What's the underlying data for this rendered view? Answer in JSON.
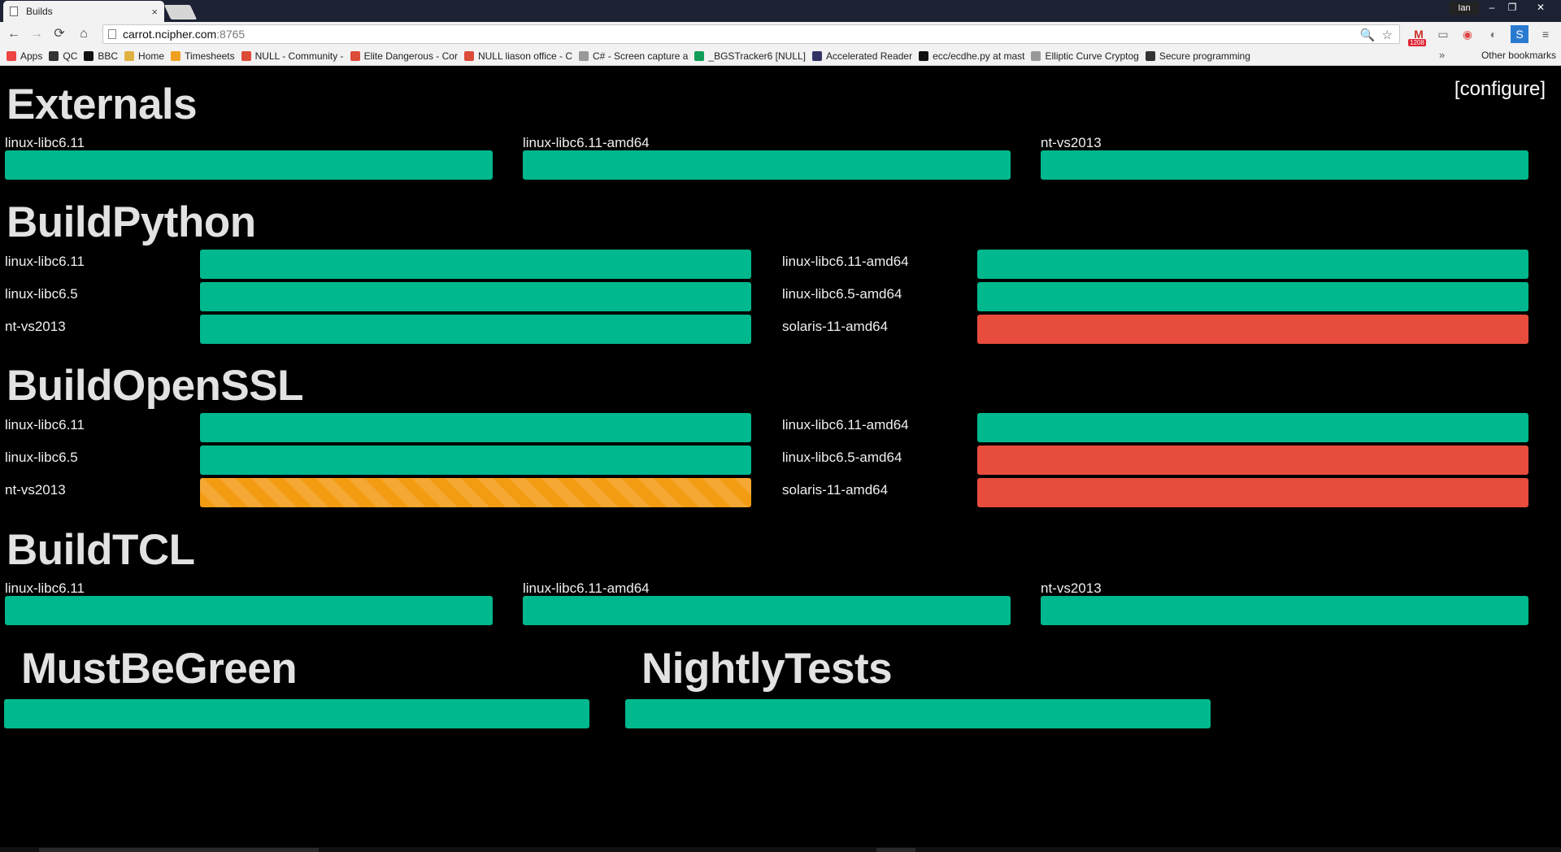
{
  "browser": {
    "tab_title": "Builds",
    "tab_close": "×",
    "user_name": "Ian",
    "url_host": "carrot.ncipher.com",
    "url_port": ":8765",
    "gmail_count": "1208",
    "bookmarks": [
      {
        "label": "Apps",
        "icon": "apps-grid-icon",
        "color": "#e44"
      },
      {
        "label": "QC",
        "icon": "qc-icon",
        "color": "#333"
      },
      {
        "label": "BBC",
        "icon": "bbc-icon",
        "color": "#111"
      },
      {
        "label": "Home",
        "icon": "folder-icon",
        "color": "#e0b040"
      },
      {
        "label": "Timesheets",
        "icon": "timesheets-icon",
        "color": "#f0a020"
      },
      {
        "label": "NULL - Community - ",
        "icon": "google-plus-icon",
        "color": "#dd4b39"
      },
      {
        "label": "Elite Dangerous - Cor",
        "icon": "google-plus-icon",
        "color": "#dd4b39"
      },
      {
        "label": "NULL liason office - C",
        "icon": "google-plus-icon",
        "color": "#dd4b39"
      },
      {
        "label": "C# - Screen capture a",
        "icon": "page-icon",
        "color": "#999"
      },
      {
        "label": "_BGSTracker6 [NULL]",
        "icon": "sheets-icon",
        "color": "#0f9d58"
      },
      {
        "label": "Accelerated Reader",
        "icon": "rl-icon",
        "color": "#336"
      },
      {
        "label": "ecc/ecdhe.py at mast",
        "icon": "github-icon",
        "color": "#111"
      },
      {
        "label": "Elliptic Curve Cryptog",
        "icon": "page-icon",
        "color": "#999"
      },
      {
        "label": "Secure programming",
        "icon": "link-icon",
        "color": "#333"
      }
    ],
    "other_bookmarks": "Other bookmarks",
    "more_bookmarks": "»"
  },
  "page": {
    "configure_label": "[configure]",
    "colors": {
      "success": "#00b88d",
      "failure": "#e74c3c",
      "building": "#f39c12"
    },
    "sections": {
      "externals": {
        "title": "Externals",
        "builders": [
          {
            "name": "linux-libc6.11",
            "status": "success"
          },
          {
            "name": "linux-libc6.11-amd64",
            "status": "success"
          },
          {
            "name": "nt-vs2013",
            "status": "success"
          }
        ]
      },
      "buildpython": {
        "title": "BuildPython",
        "builders": [
          {
            "name": "linux-libc6.11",
            "status": "success"
          },
          {
            "name": "linux-libc6.11-amd64",
            "status": "success"
          },
          {
            "name": "linux-libc6.5",
            "status": "success"
          },
          {
            "name": "linux-libc6.5-amd64",
            "status": "success"
          },
          {
            "name": "nt-vs2013",
            "status": "success"
          },
          {
            "name": "solaris-11-amd64",
            "status": "failure"
          }
        ]
      },
      "buildopenssl": {
        "title": "BuildOpenSSL",
        "builders": [
          {
            "name": "linux-libc6.11",
            "status": "success"
          },
          {
            "name": "linux-libc6.11-amd64",
            "status": "success"
          },
          {
            "name": "linux-libc6.5",
            "status": "success"
          },
          {
            "name": "linux-libc6.5-amd64",
            "status": "failure"
          },
          {
            "name": "nt-vs2013",
            "status": "building"
          },
          {
            "name": "solaris-11-amd64",
            "status": "failure"
          }
        ]
      },
      "buildtcl": {
        "title": "BuildTCL",
        "builders": [
          {
            "name": "linux-libc6.11",
            "status": "success"
          },
          {
            "name": "linux-libc6.11-amd64",
            "status": "success"
          },
          {
            "name": "nt-vs2013",
            "status": "success"
          }
        ]
      },
      "mustbegreen": {
        "title": "MustBeGreen",
        "status": "success"
      },
      "nightlytests": {
        "title": "NightlyTests",
        "status": "success"
      }
    }
  }
}
